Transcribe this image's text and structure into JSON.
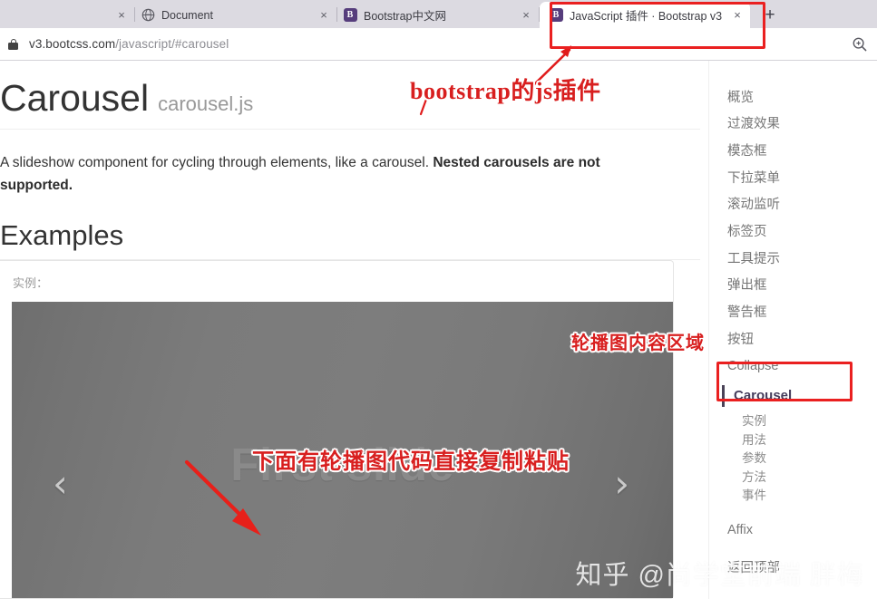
{
  "browser": {
    "tabs": [
      {
        "title": "",
        "favicon": "none",
        "active": false,
        "truncated_left": true,
        "close_label": "×"
      },
      {
        "title": "Document",
        "favicon": "globe-icon",
        "active": false,
        "close_label": "×"
      },
      {
        "title": "Bootstrap中文网",
        "favicon": "bootstrap-icon",
        "active": false,
        "close_label": "×"
      },
      {
        "title": "JavaScript 插件 · Bootstrap v3",
        "favicon": "bootstrap-icon",
        "active": true,
        "close_label": "×"
      }
    ],
    "new_tab_label": "+",
    "url": {
      "domain": "v3.bootcss.com",
      "path": "/javascript/#carousel",
      "full": "v3.bootcss.com/javascript/#carousel"
    },
    "lock_icon": "lock-icon",
    "zoom_icon": "zoom-in-icon"
  },
  "page": {
    "title": "Carousel",
    "title_sub": "carousel.js",
    "lede_normal": "A slideshow component for cycling through elements, like a carousel. ",
    "lede_bold": "Nested carousels are not supported.",
    "section_title": "Examples",
    "example_label": "实例：",
    "carousel": {
      "slide_caption": "First slide",
      "prev_label": "‹",
      "next_label": "›"
    }
  },
  "sidebar": {
    "items": [
      {
        "label": "概览",
        "type": "item"
      },
      {
        "label": "过渡效果",
        "type": "item"
      },
      {
        "label": "模态框",
        "type": "item"
      },
      {
        "label": "下拉菜单",
        "type": "item"
      },
      {
        "label": "滚动监听",
        "type": "item"
      },
      {
        "label": "标签页",
        "type": "item"
      },
      {
        "label": "工具提示",
        "type": "item"
      },
      {
        "label": "弹出框",
        "type": "item"
      },
      {
        "label": "警告框",
        "type": "item"
      },
      {
        "label": "按钮",
        "type": "item"
      },
      {
        "label": "Collapse",
        "type": "item"
      },
      {
        "label": "Carousel",
        "type": "active"
      },
      {
        "label": "实例",
        "type": "sub"
      },
      {
        "label": "用法",
        "type": "sub"
      },
      {
        "label": "参数",
        "type": "sub"
      },
      {
        "label": "方法",
        "type": "sub"
      },
      {
        "label": "事件",
        "type": "sub"
      },
      {
        "label": "",
        "type": "gap"
      },
      {
        "label": "Affix",
        "type": "item"
      },
      {
        "label": "",
        "type": "gap"
      },
      {
        "label": "返回顶部",
        "type": "item"
      }
    ]
  },
  "annotations": {
    "tab_note": "bootstrap的js插件",
    "carousel_area_note": "轮播图内容区域",
    "code_note": "下面有轮播图代码直接复制粘贴",
    "color": "#d81f1f",
    "box_color": "#ea2020"
  },
  "watermark": {
    "text": "知乎 @尚学堂前端 胖梅"
  }
}
